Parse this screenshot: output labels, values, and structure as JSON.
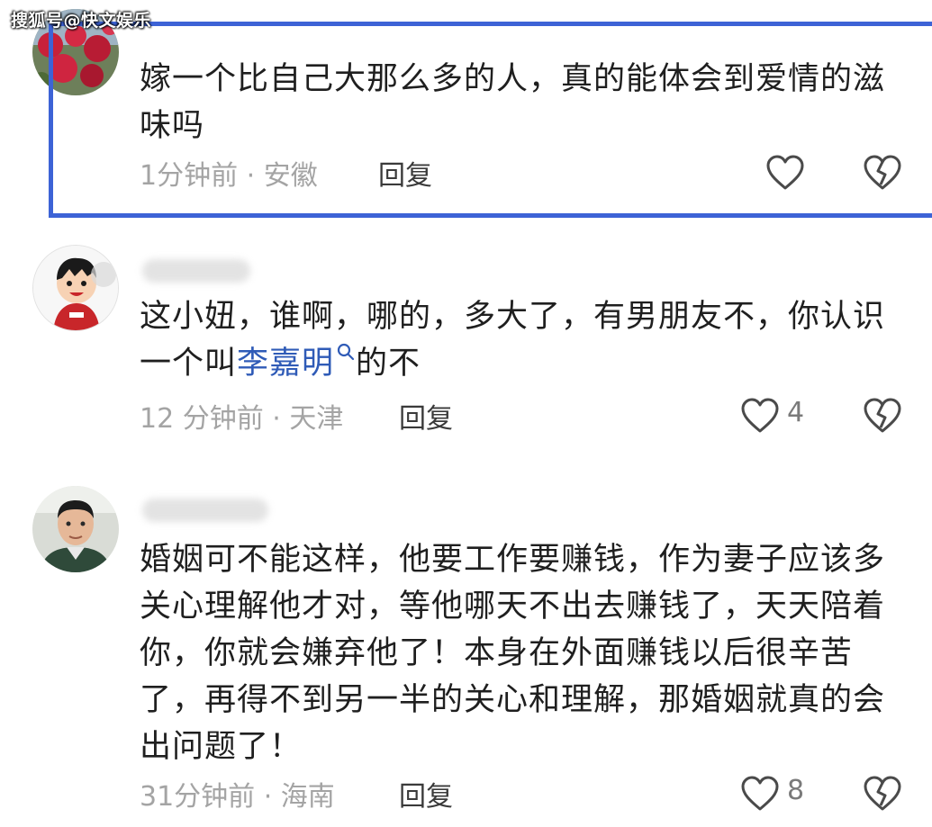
{
  "watermark": "搜狐号@快文娱乐",
  "comments": [
    {
      "text": "嫁一个比自己大那么多的人，真的能体会到爱情的滋味吗",
      "time": "1分钟前",
      "location": "安徽",
      "reply_label": "回复",
      "likes": ""
    },
    {
      "text_before": "这小妞，谁啊，哪的，多大了，有男朋友不，你认识一个叫",
      "link": "李嘉明",
      "text_after": "的不",
      "time": "12 分钟前",
      "location": "天津",
      "reply_label": "回复",
      "likes": "4"
    },
    {
      "text": "婚姻可不能这样，他要工作要赚钱，作为妻子应该多关心理解他才对，等他哪天不出去赚钱了，天天陪着你，你就会嫌弃他了！本身在外面赚钱以后很辛苦了，再得不到另一半的关心和理解，那婚姻就真的会出问题了！",
      "time": "31分钟前",
      "location": "海南",
      "reply_label": "回复",
      "likes": "8"
    }
  ],
  "meta_separator": " · ",
  "colors": {
    "highlight": "#3d63d6",
    "link": "#2f5bb7",
    "meta": "#a4a4a4"
  },
  "icons": {
    "like": "heart-outline-icon",
    "dislike": "broken-heart-icon"
  }
}
